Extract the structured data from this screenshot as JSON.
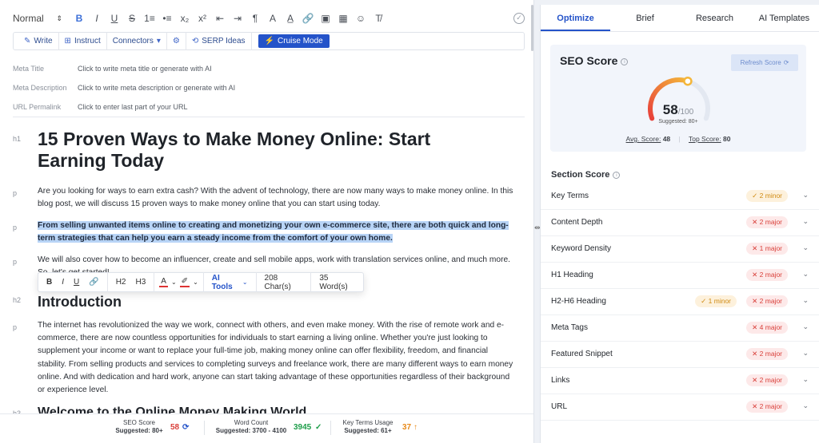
{
  "toolbar": {
    "style_select": "Normal",
    "buttons": [
      "B",
      "I",
      "U",
      "S",
      "1≡",
      "•≡",
      "x₂",
      "x²",
      "⇤",
      "⇥",
      "¶",
      "A",
      "A̲",
      "🔗",
      "▣",
      "▦",
      "☺",
      "T̸"
    ]
  },
  "ai_bar": {
    "write": "Write",
    "instruct": "Instruct",
    "connectors": "Connectors",
    "serp": "SERP Ideas",
    "cruise": "Cruise Mode"
  },
  "meta": {
    "title_label": "Meta Title",
    "title_value": "Click to write meta title or generate with AI",
    "desc_label": "Meta Description",
    "desc_value": "Click to write meta description or generate with AI",
    "permalink_label": "URL Permalink",
    "permalink_value": "Click to enter last part of your URL"
  },
  "doc": {
    "tag_h1": "h1",
    "tag_p": "p",
    "tag_h2": "h2",
    "tag_h3": "h3",
    "h1": "15 Proven Ways to Make Money Online: Start Earning Today",
    "p1": "Are you looking for ways to earn extra cash? With the advent of technology, there are now many ways to make money online. In this blog post, we will discuss 15 proven ways to make money online that you can start using today.",
    "p2": "From selling unwanted items online to creating and monetizing your own e-commerce site, there are both quick and long-term strategies that can help you earn a steady income from the comfort of your own home.",
    "p3": "We will also cover how to become an influencer, create and sell mobile apps, work with translation services online, and much more. So, let's get started!",
    "h2": "Introduction",
    "p4": "The internet has revolutionized the way we work, connect with others, and even make money. With the rise of remote work and e-commerce, there are now countless opportunities for individuals to start earning a living online. Whether you're just looking to supplement your income or want to replace your full-time job, making money online can offer flexibility, freedom, and financial stability. From selling products and services to completing surveys and freelance work, there are many different ways to earn money online. And with dedication and hard work, anyone can start taking advantage of these opportunities regardless of their background or experience level.",
    "h3": "Welcome to the Online Money Making World"
  },
  "float_bar": {
    "bold": "B",
    "italic": "I",
    "underline": "U",
    "h2": "H2",
    "h3": "H3",
    "ai_tools": "AI Tools",
    "chars": "208 Char(s)",
    "words": "35 Word(s)"
  },
  "status": {
    "seo_label": "SEO Score",
    "seo_sug": "Suggested: 80+",
    "seo_val": "58",
    "wc_label": "Word Count",
    "wc_sug": "Suggested: 3700 - 4100",
    "wc_val": "3945",
    "kt_label": "Key Terms Usage",
    "kt_sug": "Suggested: 61+",
    "kt_val": "37"
  },
  "panel": {
    "tabs": [
      "Optimize",
      "Brief",
      "Research",
      "AI Templates"
    ],
    "seo_title": "SEO Score",
    "refresh": "Refresh Score",
    "score": "58",
    "score_den": "/100",
    "score_value": 58,
    "score_max": 100,
    "suggested": "Suggested: 80+",
    "avg_label": "Avg. Score:",
    "avg_val": "48",
    "top_label": "Top Score:",
    "top_val": "80",
    "section_title": "Section Score",
    "sections": [
      {
        "name": "Key Terms",
        "minor": "2 minor",
        "major": ""
      },
      {
        "name": "Content Depth",
        "minor": "",
        "major": "2 major"
      },
      {
        "name": "Keyword Density",
        "minor": "",
        "major": "1 major"
      },
      {
        "name": "H1 Heading",
        "minor": "",
        "major": "2 major"
      },
      {
        "name": "H2-H6 Heading",
        "minor": "1 minor",
        "major": "2 major"
      },
      {
        "name": "Meta Tags",
        "minor": "",
        "major": "4 major"
      },
      {
        "name": "Featured Snippet",
        "minor": "",
        "major": "2 major"
      },
      {
        "name": "Links",
        "minor": "",
        "major": "2 major"
      },
      {
        "name": "URL",
        "minor": "",
        "major": "2 major"
      }
    ]
  },
  "colors": {
    "accent": "#2453c9",
    "major": "#d9403a",
    "minor": "#cf8a12",
    "good": "#1e9e4a",
    "warn": "#e88a1a"
  }
}
